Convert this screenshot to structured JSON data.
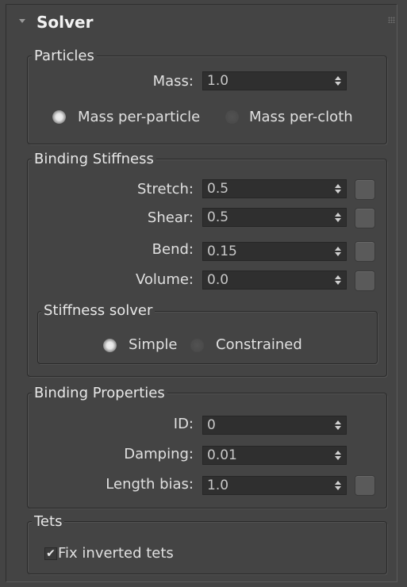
{
  "rollout": {
    "title": "Solver"
  },
  "particles": {
    "title": "Particles",
    "mass_label": "Mass:",
    "mass_value": "1.0",
    "mode_options": [
      "Mass per-particle",
      "Mass per-cloth"
    ],
    "mode_selected": "Mass per-particle"
  },
  "binding_stiffness": {
    "title": "Binding Stiffness",
    "rows": [
      {
        "label": "Stretch:",
        "value": "0.5"
      },
      {
        "label": "Shear:",
        "value": "0.5"
      },
      {
        "label": "Bend:",
        "value": "0.15"
      },
      {
        "label": "Volume:",
        "value": "0.0"
      }
    ],
    "solver": {
      "title": "Stiffness solver",
      "options": [
        "Simple",
        "Constrained"
      ],
      "selected": "Simple"
    }
  },
  "binding_properties": {
    "title": "Binding Properties",
    "rows": [
      {
        "label": "ID:",
        "value": "0"
      },
      {
        "label": "Damping:",
        "value": "0.01"
      },
      {
        "label": "Length bias:",
        "value": "1.0"
      }
    ]
  },
  "tets": {
    "title": "Tets",
    "fix_inverted_label": "Fix inverted tets",
    "fix_inverted_checked": true,
    "check_glyph": "✔"
  }
}
